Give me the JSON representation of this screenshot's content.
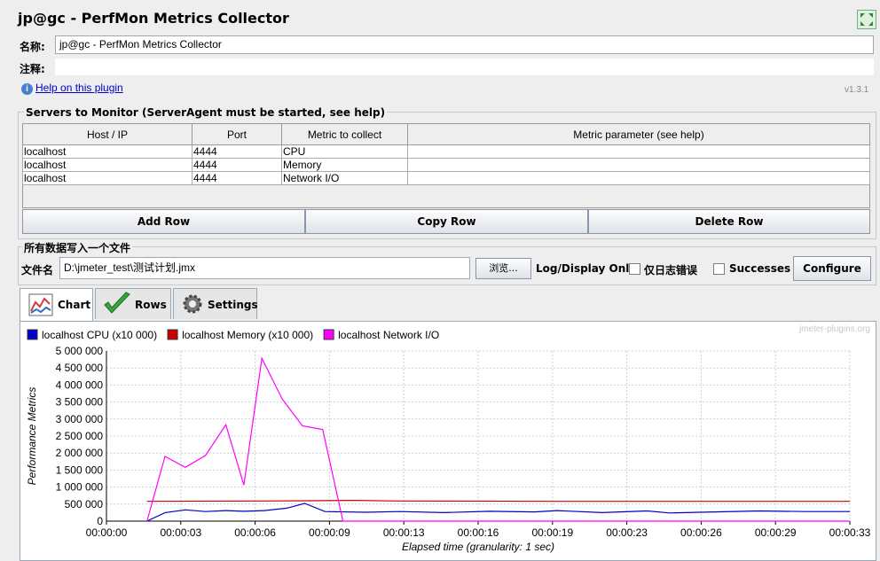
{
  "window": {
    "title": "jp@gc - PerfMon Metrics Collector"
  },
  "form": {
    "name_label": "名称:",
    "name_value": "jp@gc - PerfMon Metrics Collector",
    "comment_label": "注释:",
    "comment_value": "",
    "help_link": "Help on this plugin",
    "version": "v1.3.1"
  },
  "servers": {
    "group_title": "Servers to Monitor (ServerAgent must be started, see help)",
    "columns": [
      "Host / IP",
      "Port",
      "Metric to collect",
      "Metric parameter (see help)"
    ],
    "rows": [
      [
        "localhost",
        "4444",
        "CPU",
        ""
      ],
      [
        "localhost",
        "4444",
        "Memory",
        ""
      ],
      [
        "localhost",
        "4444",
        "Network I/O",
        ""
      ]
    ],
    "buttons": {
      "add": "Add Row",
      "copy": "Copy Row",
      "delete": "Delete Row"
    }
  },
  "file": {
    "group_title": "所有数据写入一个文件",
    "filename_label": "文件名",
    "filename_value": "D:\\jmeter_test\\测试计划.jmx",
    "browse": "浏览...",
    "log_label": "Log/Display Only:",
    "errors_label": "仅日志错误",
    "errors_checked": false,
    "successes_label": "Successes",
    "successes_checked": false,
    "configure": "Configure"
  },
  "tabs": [
    {
      "label": "Chart",
      "icon": "chart-icon",
      "active": true
    },
    {
      "label": "Rows",
      "icon": "checkmark-icon",
      "active": false
    },
    {
      "label": "Settings",
      "icon": "gear-icon",
      "active": false
    }
  ],
  "chart_data": {
    "type": "line",
    "watermark": "jmeter-plugins.org",
    "ylabel": "Performance Metrics",
    "xlabel": "Elapsed time (granularity: 1 sec)",
    "ylim": [
      0,
      5000000
    ],
    "yticks": [
      "0",
      "500 000",
      "1 000 000",
      "1 500 000",
      "2 000 000",
      "2 500 000",
      "3 000 000",
      "3 500 000",
      "4 000 000",
      "4 500 000",
      "5 000 000"
    ],
    "xticks": [
      "00:00:00",
      "00:00:03",
      "00:00:06",
      "00:00:09",
      "00:00:13",
      "00:00:16",
      "00:00:19",
      "00:00:23",
      "00:00:26",
      "00:00:29",
      "00:00:33"
    ],
    "xlim": [
      0,
      33
    ],
    "grid": true,
    "legend_position": "top-left",
    "series": [
      {
        "name": "localhost CPU (x10 000)",
        "color": "#0000cc",
        "points": [
          [
            1.8,
            0
          ],
          [
            2.6,
            250000
          ],
          [
            3.5,
            330000
          ],
          [
            4.4,
            280000
          ],
          [
            5.3,
            310000
          ],
          [
            6.1,
            290000
          ],
          [
            7.0,
            310000
          ],
          [
            8.0,
            380000
          ],
          [
            8.8,
            520000
          ],
          [
            9.7,
            280000
          ],
          [
            11.5,
            260000
          ],
          [
            13.0,
            280000
          ],
          [
            15,
            250000
          ],
          [
            17,
            290000
          ],
          [
            19,
            270000
          ],
          [
            20,
            310000
          ],
          [
            22,
            250000
          ],
          [
            24,
            300000
          ],
          [
            25,
            240000
          ],
          [
            27,
            270000
          ],
          [
            29,
            300000
          ],
          [
            31,
            280000
          ],
          [
            33,
            280000
          ]
        ]
      },
      {
        "name": "localhost Memory (x10 000)",
        "color": "#cc0000",
        "points": [
          [
            1.8,
            580000
          ],
          [
            7.0,
            590000
          ],
          [
            9.0,
            600000
          ],
          [
            11.0,
            610000
          ],
          [
            13.0,
            590000
          ],
          [
            20,
            580000
          ],
          [
            33,
            580000
          ]
        ]
      },
      {
        "name": "localhost Network I/O",
        "color": "#ff00ff",
        "points": [
          [
            1.8,
            0
          ],
          [
            2.6,
            1900000
          ],
          [
            3.5,
            1580000
          ],
          [
            4.4,
            1930000
          ],
          [
            5.3,
            2830000
          ],
          [
            6.1,
            1060000
          ],
          [
            6.9,
            4780000
          ],
          [
            7.8,
            3590000
          ],
          [
            8.7,
            2800000
          ],
          [
            9.6,
            2690000
          ],
          [
            10.5,
            0
          ],
          [
            33,
            0
          ]
        ]
      }
    ]
  }
}
